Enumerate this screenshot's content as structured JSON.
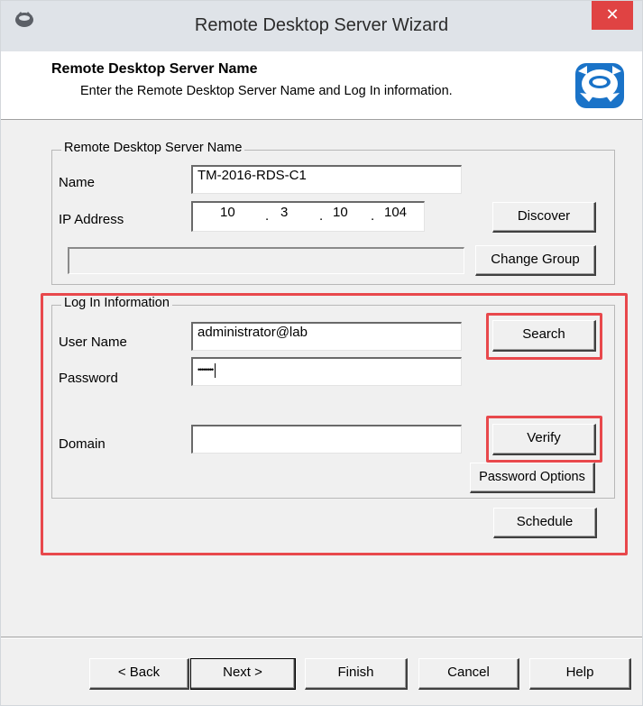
{
  "window": {
    "title": "Remote Desktop Server Wizard",
    "close_glyph": "✕"
  },
  "header": {
    "title": "Remote Desktop Server Name",
    "subtitle": "Enter the Remote Desktop Server Name and Log In information."
  },
  "server_group": {
    "legend": "Remote Desktop Server Name",
    "name_label": "Name",
    "name_value": "TM-2016-RDS-C1",
    "ip_label": "IP Address",
    "ip_octets": [
      "10",
      "3",
      "10",
      "104"
    ],
    "ip_separator": ".",
    "discover_label": "Discover",
    "group_value": "",
    "change_group_label": "Change Group"
  },
  "login_group": {
    "legend": "Log In Information",
    "user_label": "User Name",
    "user_value": "administrator@lab",
    "password_label": "Password",
    "password_value": "••••••••",
    "domain_label": "Domain",
    "domain_value": "",
    "search_label": "Search",
    "verify_label": "Verify",
    "password_options_label": "Password Options"
  },
  "schedule_label": "Schedule",
  "footer": {
    "back_label": "< Back",
    "next_label": "Next >",
    "finish_label": "Finish",
    "cancel_label": "Cancel",
    "help_label": "Help"
  },
  "colors": {
    "highlight": "#e8484c",
    "close_button": "#e04343",
    "logo_blue": "#1a73c8"
  },
  "icons": {
    "app": "thinman-app-icon",
    "logo": "thinman-logo-icon",
    "close": "close-icon"
  }
}
